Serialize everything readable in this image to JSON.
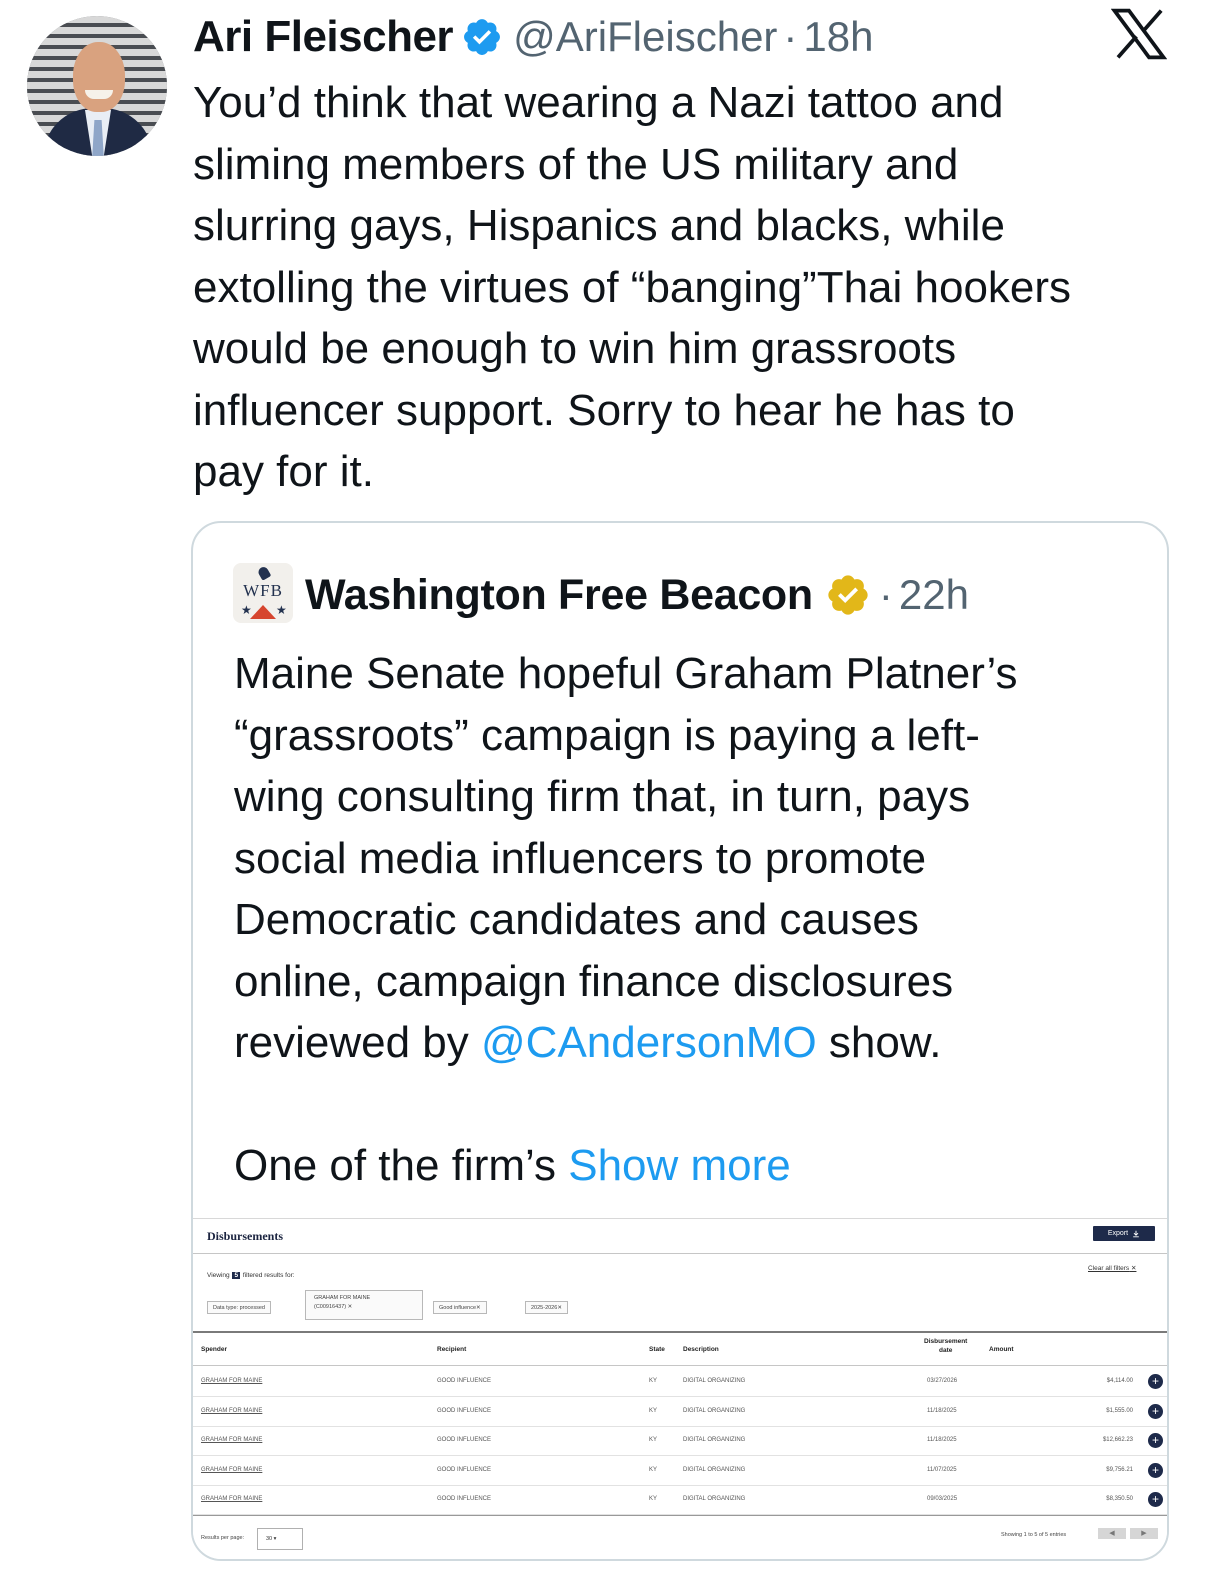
{
  "tweet": {
    "author_name": "Ari Fleischer",
    "handle": "@AriFleischer",
    "separator": "·",
    "time": "18h",
    "text_lines": [
      "You’d think that wearing a Nazi tattoo and",
      "sliming members of the US military and",
      "slurring gays, Hispanics and blacks, while",
      "extolling the virtues of “banging”Thai hookers",
      "would be enough to win him grassroots",
      "influencer support. Sorry to hear he has to",
      "pay for it."
    ]
  },
  "quoted": {
    "logo_text": "WFB",
    "author_name": "Washington Free Beacon",
    "separator": "·",
    "time": "22h",
    "text_lines": [
      "Maine Senate hopeful Graham Platner’s",
      "“grassroots” campaign is paying a left-",
      "wing consulting firm that, in turn, pays",
      "social media influencers to promote",
      "Democratic candidates and causes",
      "online, campaign finance disclosures"
    ],
    "last_line_prefix": "reviewed by ",
    "mention": "@CAndersonMO",
    "last_line_suffix": " show.",
    "truncated_prefix": "One of the firm’s ",
    "show_more": "Show more"
  },
  "screenshot": {
    "title": "Disbursements",
    "export_label": "Export",
    "viewing_prefix": "Viewing",
    "viewing_count": "5",
    "viewing_suffix": "filtered results for:",
    "clear_filters": "Clear all filters",
    "filters": {
      "data_type": "Data type: processed",
      "committee_line1": "GRAHAM FOR MAINE",
      "committee_line2": "(C00916437)",
      "recipient": "Good influence",
      "period": "2025-2026"
    },
    "columns": {
      "spender": "Spender",
      "recipient": "Recipient",
      "state": "State",
      "description": "Description",
      "date_line1": "Disbursement",
      "date_line2": "date",
      "amount": "Amount"
    },
    "rows": [
      {
        "spender": "GRAHAM FOR MAINE",
        "recipient": "GOOD INFLUENCE",
        "state": "KY",
        "description": "DIGITAL ORGANIZING",
        "date": "03/27/2026",
        "amount": "$4,114.00"
      },
      {
        "spender": "GRAHAM FOR MAINE",
        "recipient": "GOOD INFLUENCE",
        "state": "KY",
        "description": "DIGITAL ORGANIZING",
        "date": "11/18/2025",
        "amount": "$1,555.00"
      },
      {
        "spender": "GRAHAM FOR MAINE",
        "recipient": "GOOD INFLUENCE",
        "state": "KY",
        "description": "DIGITAL ORGANIZING",
        "date": "11/18/2025",
        "amount": "$12,662.23"
      },
      {
        "spender": "GRAHAM FOR MAINE",
        "recipient": "GOOD INFLUENCE",
        "state": "KY",
        "description": "DIGITAL ORGANIZING",
        "date": "11/07/2025",
        "amount": "$9,756.21"
      },
      {
        "spender": "GRAHAM FOR MAINE",
        "recipient": "GOOD INFLUENCE",
        "state": "KY",
        "description": "DIGITAL ORGANIZING",
        "date": "09/03/2025",
        "amount": "$8,350.50"
      }
    ],
    "results_per_page_label": "Results per page:",
    "results_per_page_value": "30",
    "showing": "Showing 1 to 5 of 5 entries"
  },
  "colors": {
    "text": "#0f1419",
    "secondary": "#536471",
    "link": "#1d9bf0",
    "verified_blue": "#1d9bf0",
    "verified_gold": "#e2b719",
    "border": "#cfd9de",
    "navy": "#1e2a4a"
  },
  "icons": {
    "verified": "verified-badge-icon",
    "gold_verified": "gold-verified-badge-icon",
    "x_logo": "x-logo-icon",
    "export": "download-icon",
    "row_expand": "plus-circle-icon"
  }
}
